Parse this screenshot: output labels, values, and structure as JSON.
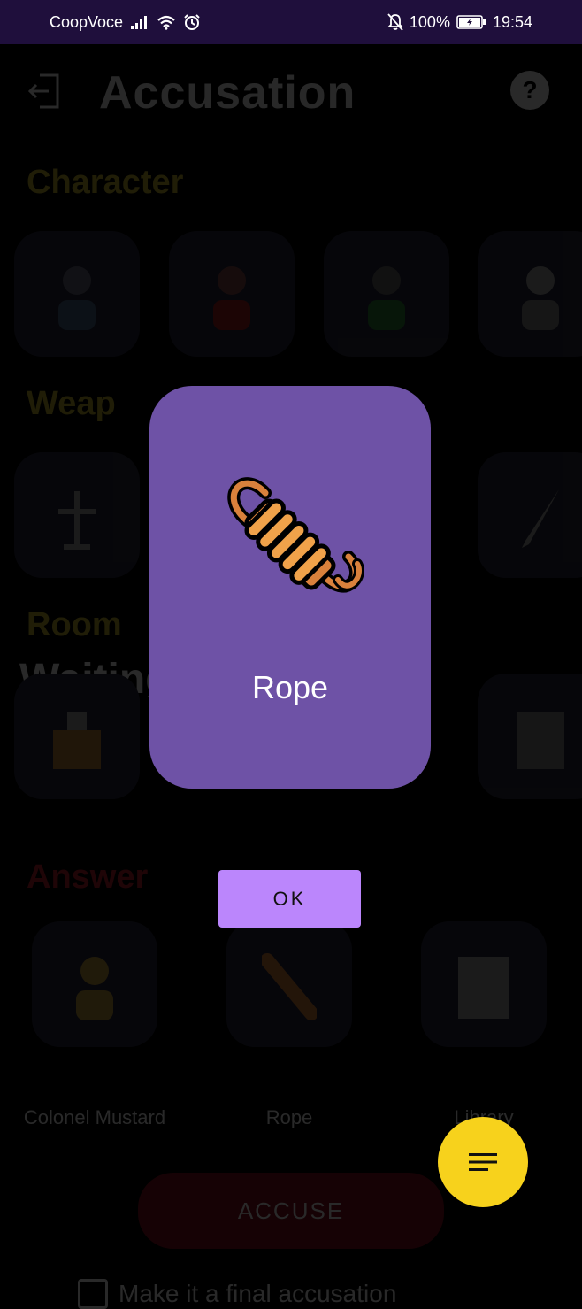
{
  "status_bar": {
    "carrier": "CoopVoce",
    "battery": "100%",
    "time": "19:54"
  },
  "header": {
    "title": "Accusation"
  },
  "sections": {
    "character": "Character",
    "weapon": "Weap",
    "room": "Room",
    "answer": "Answer"
  },
  "waiting_text": "Waiting for Mario to",
  "answer_labels": [
    "Colonel Mustard",
    "Rope",
    "Library"
  ],
  "accuse_label": "ACCUSE",
  "final_accusation_label": "Make it a final accusation",
  "dialog": {
    "card_title": "Rope",
    "ok_label": "OK"
  },
  "colors": {
    "status_bar": "#1f0f3c",
    "card": "#6e52a6",
    "ok_button": "#bb86fc",
    "fab": "#f7d21c",
    "rope_light": "#f0a24a",
    "rope_dark": "#d9813c"
  },
  "icons": {
    "exit": "exit-icon",
    "help": "help-icon",
    "rope": "rope-icon",
    "menu": "menu-icon"
  }
}
